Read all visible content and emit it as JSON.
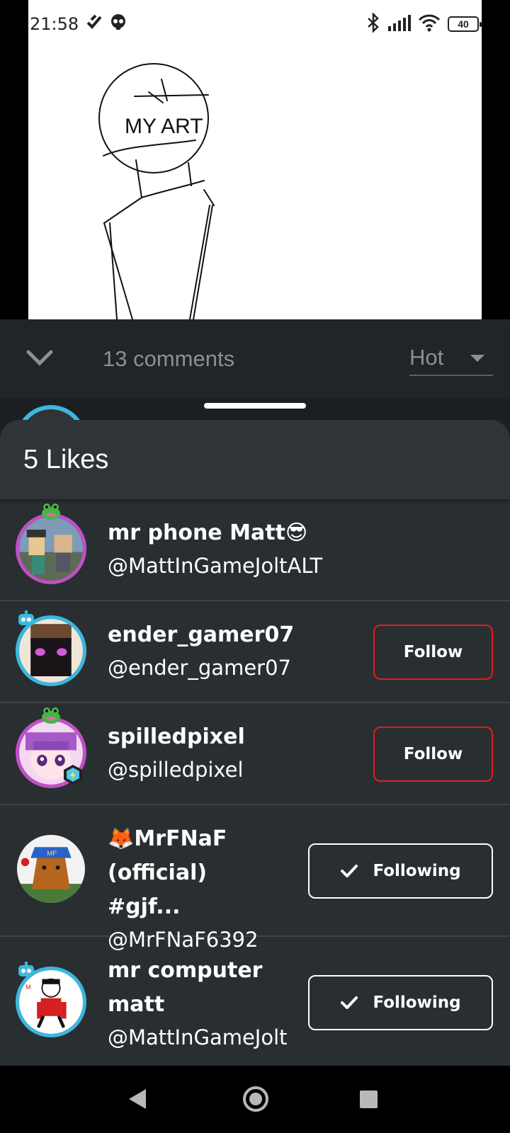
{
  "status_bar": {
    "time": "21:58",
    "battery": "40"
  },
  "post": {
    "image_text": "MY ART"
  },
  "comments_bar": {
    "count_label": "13 comments",
    "sort_selected": "Hot"
  },
  "likes_sheet": {
    "title": "5 Likes",
    "users": [
      {
        "display_name": "mr phone Matt😎",
        "handle": "@MattInGameJoltALT",
        "action": ""
      },
      {
        "display_name": "ender_gamer07",
        "handle": "@ender_gamer07",
        "action": "Follow"
      },
      {
        "display_name": "spilledpixel",
        "handle": "@spilledpixel",
        "action": "Follow"
      },
      {
        "display_name": "🦊MrFNaF (official) #gjf...",
        "handle": "@MrFNaF6392",
        "action": "Following"
      },
      {
        "display_name": "mr computer matt",
        "handle": "@MattInGameJolt",
        "action": "Following"
      }
    ]
  },
  "colors": {
    "sheet_bg": "#292e31",
    "follow_border": "#e31d1d",
    "following_border": "#ffffff",
    "avatar_ring_blue": "#3ab8e0",
    "avatar_ring_pink": "#c04fc8"
  }
}
